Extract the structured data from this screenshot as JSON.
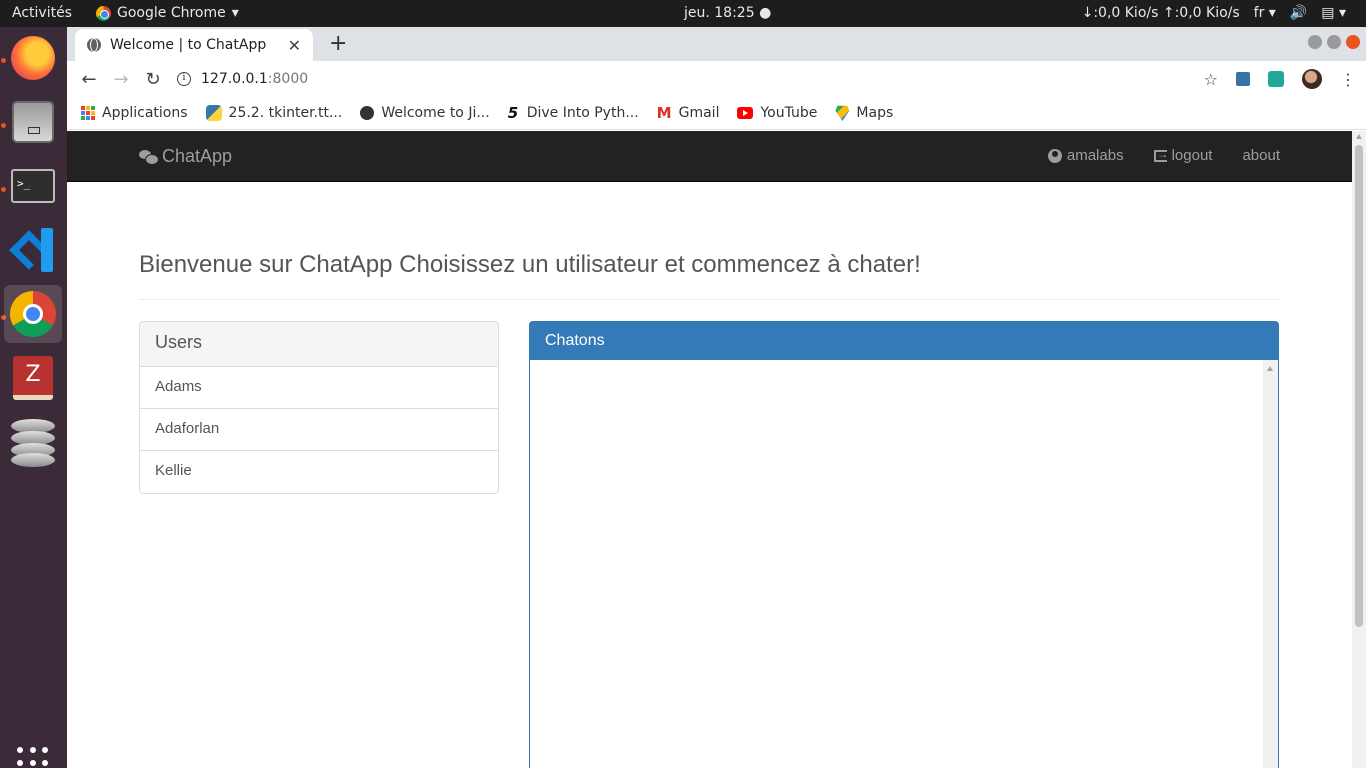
{
  "system": {
    "activities": "Activités",
    "app_menu": "Google Chrome",
    "clock": "jeu. 18:25",
    "network": "↓:0,0 Kio/s ↑:0,0 Kio/s",
    "language": "fr"
  },
  "dock": {
    "apps": [
      "firefox-icon",
      "files-icon",
      "terminal-icon",
      "vscode-icon",
      "chrome-icon",
      "zotero-icon",
      "database-icon"
    ]
  },
  "browser": {
    "tab_title": "Welcome | to ChatApp",
    "url_host": "127.0.0.1",
    "url_port": ":8000",
    "bookmarks": [
      {
        "label": "Applications",
        "icon": "apps-icon"
      },
      {
        "label": "25.2. tkinter.tt...",
        "icon": "python-icon"
      },
      {
        "label": "Welcome to Ji...",
        "icon": "globe-icon"
      },
      {
        "label": "Dive Into Pyth...",
        "icon": "dive-icon"
      },
      {
        "label": "Gmail",
        "icon": "gmail-icon"
      },
      {
        "label": "YouTube",
        "icon": "youtube-icon"
      },
      {
        "label": "Maps",
        "icon": "maps-icon"
      }
    ]
  },
  "app": {
    "brand": "ChatApp",
    "nav": {
      "user": "amalabs",
      "logout": "logout",
      "about": "about"
    },
    "heading": "Bienvenue sur ChatApp Choisissez un utilisateur et commencez à chater!",
    "users_title": "Users",
    "users": [
      "Adams",
      "Adaforlan",
      "Kellie"
    ],
    "chat_title": "Chatons"
  },
  "colors": {
    "navbar": "#222222",
    "accent": "#337ab7",
    "dock": "#3b2a38"
  }
}
